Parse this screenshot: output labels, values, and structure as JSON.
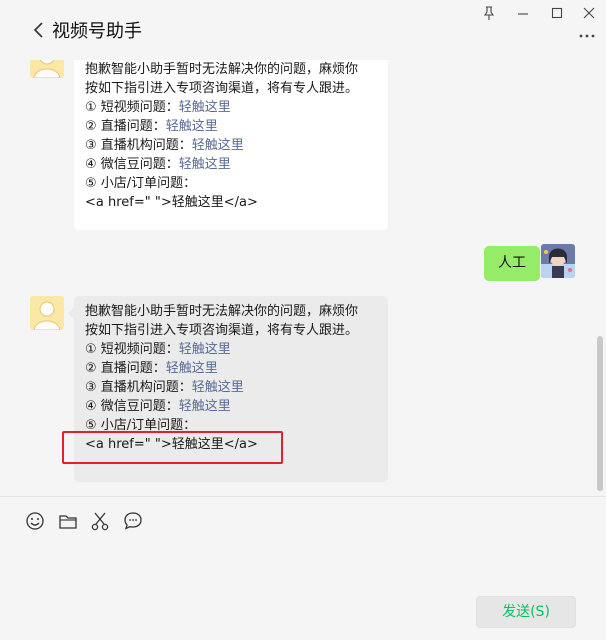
{
  "window": {
    "title": "视频号助手",
    "controls": [
      "pin-icon",
      "minimize-icon",
      "maximize-icon",
      "close-icon"
    ],
    "more_icon": "more-icon"
  },
  "colors": {
    "background": "#f5f5f5",
    "bubble_white": "#ffffff",
    "bubble_grey": "#ebebeb",
    "user_bubble": "#95ec69",
    "link": "#576b95",
    "send_text": "#07c160",
    "highlight": "#e2212a"
  },
  "messages": [
    {
      "sender": "assistant",
      "partial": true,
      "lines": [
        "抱歉智能小助手暂时无法解决你的问题，麻烦你",
        "按如下指引进入专项咨询渠道，将有专人跟进。"
      ],
      "items": [
        {
          "label": "① 短视频问题：",
          "link": "轻触这里"
        },
        {
          "label": "② 直播问题：",
          "link": "轻触这里"
        },
        {
          "label": "③ 直播机构问题：",
          "link": "轻触这里"
        },
        {
          "label": "④ 微信豆问题：",
          "link": "轻触这里"
        },
        {
          "label": "⑤ 小店/订单问题：",
          "link": ""
        }
      ],
      "raw_line": "<a href=\" \">轻触这里</a>"
    },
    {
      "sender": "user",
      "text": "人工"
    },
    {
      "sender": "assistant",
      "lines": [
        "抱歉智能小助手暂时无法解决你的问题，麻烦你",
        "按如下指引进入专项咨询渠道，将有专人跟进。"
      ],
      "items": [
        {
          "label": "① 短视频问题：",
          "link": "轻触这里"
        },
        {
          "label": "② 直播问题：",
          "link": "轻触这里"
        },
        {
          "label": "③ 直播机构问题：",
          "link": "轻触这里"
        },
        {
          "label": "④ 微信豆问题：",
          "link": "轻触这里"
        },
        {
          "label": "⑤ 小店/订单问题：",
          "link": ""
        }
      ],
      "raw_line": "<a href=\" \">轻触这里</a>"
    }
  ],
  "toolbar": {
    "icons": [
      "emoji-icon",
      "folder-icon",
      "scissors-icon",
      "chat-bubble-icon"
    ]
  },
  "input": {
    "value": ""
  },
  "send_button": {
    "label": "发送(S)"
  }
}
